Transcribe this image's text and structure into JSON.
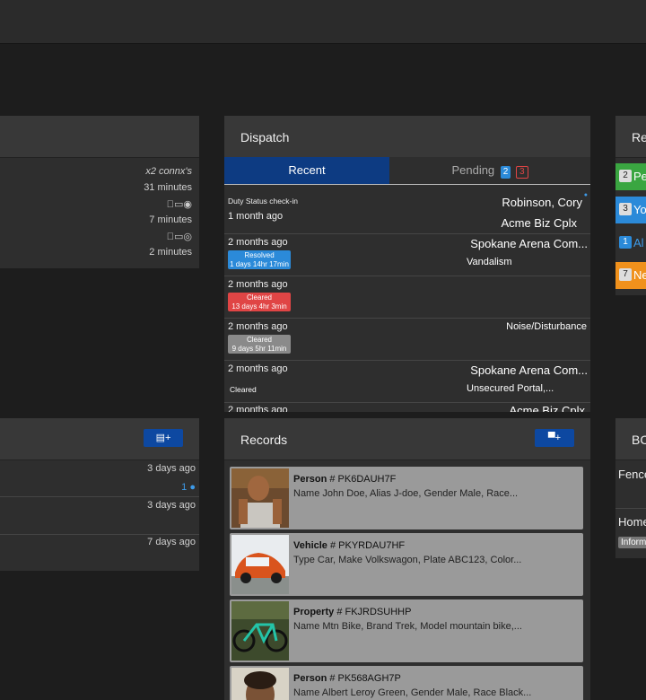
{
  "left_top": {
    "rows": [
      {
        "text": "x2 connx's"
      },
      {
        "text": "31 minutes"
      },
      {
        "text": "7 minutes"
      },
      {
        "text": "2 minutes"
      }
    ]
  },
  "left_bottom": {
    "rows": [
      {
        "time": "3 days ago"
      },
      {
        "count": "1"
      },
      {
        "time": "3 days ago"
      },
      {
        "time": "7 days ago"
      }
    ]
  },
  "dispatch": {
    "title": "Dispatch",
    "tab_recent": "Recent",
    "tab_pending": "Pending",
    "pending_blue": "2",
    "pending_red": "3",
    "items": [
      {
        "label": "Duty Status check-in",
        "time": "1 month ago",
        "right1": "Robinson, Cory",
        "right2": "Acme Biz Cplx"
      },
      {
        "time": "2 months ago",
        "right1": "Spokane Arena Com...",
        "right2": "Vandalism",
        "status": "Resolved",
        "duration": "1 days 14hr 17min"
      },
      {
        "time": "2 months ago",
        "status": "Cleared",
        "duration": "13 days 4hr 3min"
      },
      {
        "time": "2 months ago",
        "right2": "Noise/Disturbance",
        "status": "Cleared",
        "duration": "9 days 5hr 11min"
      },
      {
        "time": "2 months ago",
        "right1": "Spokane Arena Com...",
        "right2": "Unsecured Portal,...",
        "status": "Cleared"
      }
    ],
    "partial_time": "2 months ago",
    "partial_right": "Acme Biz Cplx"
  },
  "records": {
    "title": "Records",
    "items": [
      {
        "type": "Person",
        "id": "# PK6DAUH7F",
        "desc": "Name John Doe, Alias J-doe, Gender Male, Race..."
      },
      {
        "type": "Vehicle",
        "id": "# PKYRDAU7HF",
        "desc": "Type Car, Make Volkswagon, Plate ABC123, Color..."
      },
      {
        "type": "Property",
        "id": "# FKJRDSUHHP",
        "desc": "Name Mtn Bike, Brand Trek, Model mountain bike,..."
      },
      {
        "type": "Person",
        "id": "# PK568AGH7P",
        "desc": "Name Albert Leroy Green, Gender Male, Race Black..."
      }
    ]
  },
  "right_top": {
    "title": "Re",
    "items": [
      {
        "num": "2",
        "label": "Pe"
      },
      {
        "num": "3",
        "label": "Yo"
      },
      {
        "num": "1",
        "label": "Al"
      },
      {
        "num": "7",
        "label": "Ne"
      }
    ]
  },
  "right_bottom": {
    "title": "BC",
    "line1": "Fence",
    "line2": "Home",
    "badge": "Inform"
  },
  "colors": {
    "accent": "#0d48a1",
    "resolved": "#2b8ad9",
    "cleared_red": "#e04545",
    "cleared_gray": "#8a8a8a",
    "green": "#3aa641",
    "orange": "#f0911c"
  }
}
